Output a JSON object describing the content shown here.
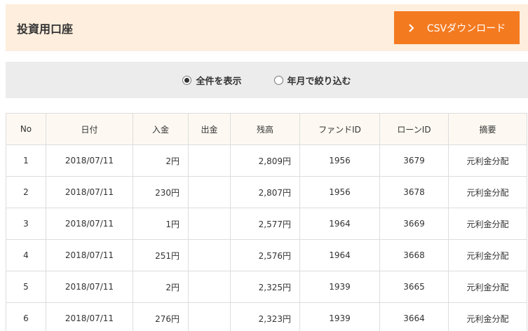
{
  "header": {
    "title": "投資用口座",
    "csv_button_label": "CSVダウンロード"
  },
  "filter": {
    "options": [
      {
        "label": "全件を表示",
        "selected": true
      },
      {
        "label": "年月で絞り込む",
        "selected": false
      }
    ]
  },
  "table": {
    "columns": [
      "No",
      "日付",
      "入金",
      "出金",
      "残高",
      "ファンドID",
      "ローンID",
      "摘要"
    ],
    "rows": [
      {
        "no": "1",
        "date": "2018/07/11",
        "deposit": "2円",
        "withdrawal": "",
        "balance": "2,809円",
        "fund_id": "1956",
        "loan_id": "3679",
        "summary": "元利金分配"
      },
      {
        "no": "2",
        "date": "2018/07/11",
        "deposit": "230円",
        "withdrawal": "",
        "balance": "2,807円",
        "fund_id": "1956",
        "loan_id": "3678",
        "summary": "元利金分配"
      },
      {
        "no": "3",
        "date": "2018/07/11",
        "deposit": "1円",
        "withdrawal": "",
        "balance": "2,577円",
        "fund_id": "1964",
        "loan_id": "3669",
        "summary": "元利金分配"
      },
      {
        "no": "4",
        "date": "2018/07/11",
        "deposit": "251円",
        "withdrawal": "",
        "balance": "2,576円",
        "fund_id": "1964",
        "loan_id": "3668",
        "summary": "元利金分配"
      },
      {
        "no": "5",
        "date": "2018/07/11",
        "deposit": "2円",
        "withdrawal": "",
        "balance": "2,325円",
        "fund_id": "1939",
        "loan_id": "3665",
        "summary": "元利金分配"
      },
      {
        "no": "6",
        "date": "2018/07/11",
        "deposit": "276円",
        "withdrawal": "",
        "balance": "2,323円",
        "fund_id": "1939",
        "loan_id": "3664",
        "summary": "元利金分配"
      }
    ]
  },
  "colors": {
    "accent": "#f47a20",
    "header_bg": "#fdeedd",
    "filter_bg": "#ececec"
  }
}
